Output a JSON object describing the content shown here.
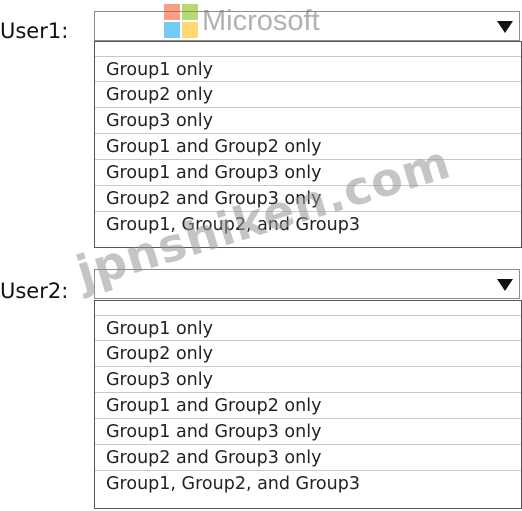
{
  "questions": [
    {
      "label": "User1:",
      "options": [
        "Group1 only",
        "Group2 only",
        "Group3 only",
        "Group1 and Group2 only",
        "Group1 and Group3 only",
        "Group2 and Group3 only",
        "Group1, Group2, and Group3"
      ]
    },
    {
      "label": "User2:",
      "options": [
        "Group1 only",
        "Group2 only",
        "Group3 only",
        "Group1 and Group2 only",
        "Group1 and Group3 only",
        "Group2 and Group3 only",
        "Group1, Group2, and Group3"
      ]
    }
  ],
  "watermarks": {
    "logo_text": "Microsoft",
    "site_text": "jpnshiken.com"
  },
  "colors": {
    "logo_red": "#f25022",
    "logo_green": "#7fba00",
    "logo_blue": "#00a4ef",
    "logo_yellow": "#ffb900"
  },
  "icons": {
    "dropdown": "triangle-down-icon",
    "logo": "microsoft-logo"
  }
}
